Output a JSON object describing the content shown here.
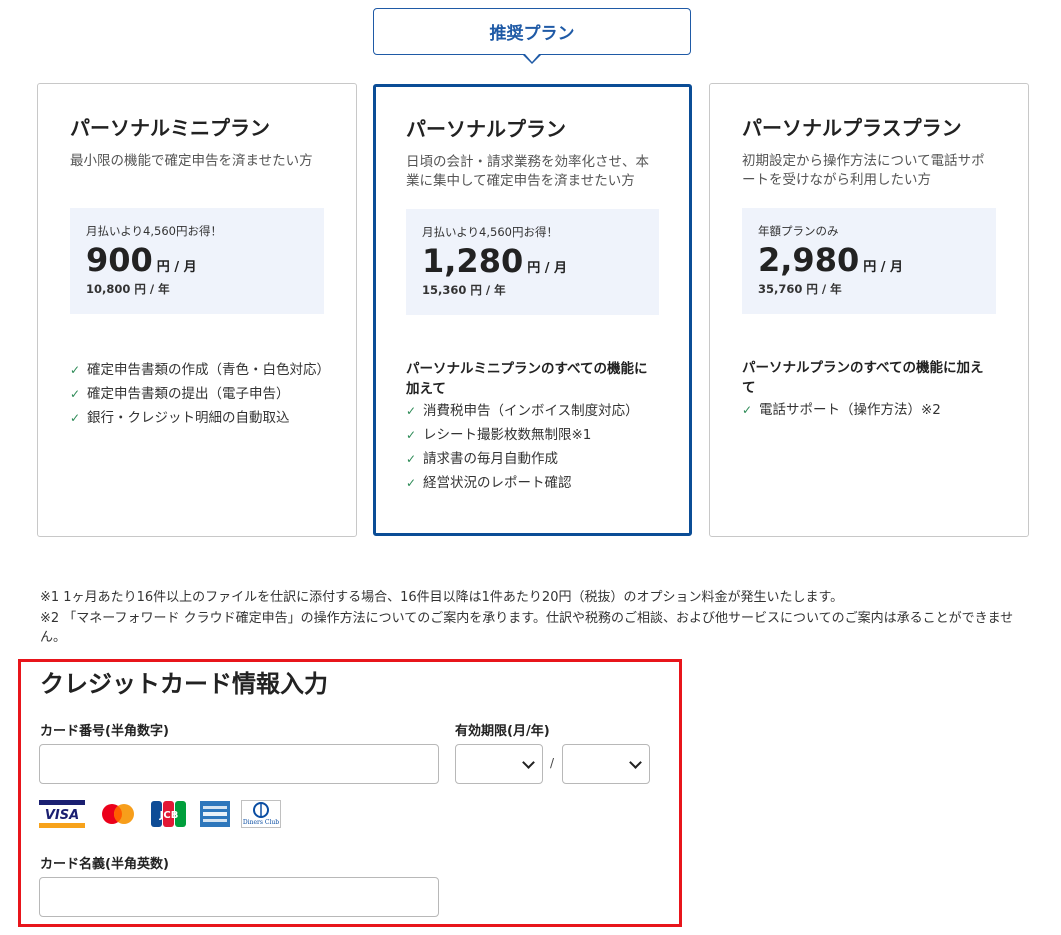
{
  "badge": {
    "label": "推奨プラン"
  },
  "plans": [
    {
      "name": "パーソナルミニプラン",
      "description": "最小限の機能で確定申告を済ませたい方",
      "price_note": "月払いより4,560円お得！",
      "price": "900",
      "unit": "円 / 月",
      "yearly": "10,800 円 / 年",
      "features_heading": "",
      "features": [
        "確定申告書類の作成（青色・白色対応）",
        "確定申告書類の提出（電子申告）",
        "銀行・クレジット明細の自動取込"
      ]
    },
    {
      "name": "パーソナルプラン",
      "description": "日頃の会計・請求業務を効率化させ、本業に集中して確定申告を済ませたい方",
      "price_note": "月払いより4,560円お得！",
      "price": "1,280",
      "unit": "円 / 月",
      "yearly": "15,360 円 / 年",
      "features_heading": "パーソナルミニプランのすべての機能に加えて",
      "features": [
        "消費税申告（インボイス制度対応）",
        "レシート撮影枚数無制限※1",
        "請求書の毎月自動作成",
        "経営状況のレポート確認"
      ]
    },
    {
      "name": "パーソナルプラスプラン",
      "description": "初期設定から操作方法について電話サポートを受けながら利用したい方",
      "price_note": "年額プランのみ",
      "price": "2,980",
      "unit": "円 / 月",
      "yearly": "35,760 円 / 年",
      "features_heading": "パーソナルプランのすべての機能に加えて",
      "features": [
        "電話サポート（操作方法）※2"
      ]
    }
  ],
  "notes": [
    "※1 1ヶ月あたり16件以上のファイルを仕訳に添付する場合、16件目以降は1件あたり20円（税抜）のオプション料金が発生いたします。",
    "※2 「マネーフォワード クラウド確定申告」の操作方法についてのご案内を承ります。仕訳や税務のご相談、および他サービスについてのご案内は承ることができません。"
  ],
  "credit_card": {
    "title": "クレジットカード情報入力",
    "card_number_label": "カード番号(半角数字)",
    "card_number_value": "",
    "expiry_label": "有効期限(月/年)",
    "expiry_month_value": "",
    "expiry_year_value": "",
    "expiry_separator": "/",
    "holder_label": "カード名義(半角英数)",
    "holder_value": "",
    "brands": [
      {
        "icon": "visa-icon",
        "text": "VISA"
      },
      {
        "icon": "mastercard-icon",
        "text": ""
      },
      {
        "icon": "jcb-icon",
        "text": "JCB"
      },
      {
        "icon": "amex-icon",
        "text": ""
      },
      {
        "icon": "diners-club-icon",
        "text": "Diners Club"
      }
    ]
  },
  "colors": {
    "accent": "#1f5aa6",
    "featured_border": "#0b4d96",
    "price_bg": "#eff3fb",
    "check": "#2e8b57",
    "highlight_border": "#e8151b"
  }
}
